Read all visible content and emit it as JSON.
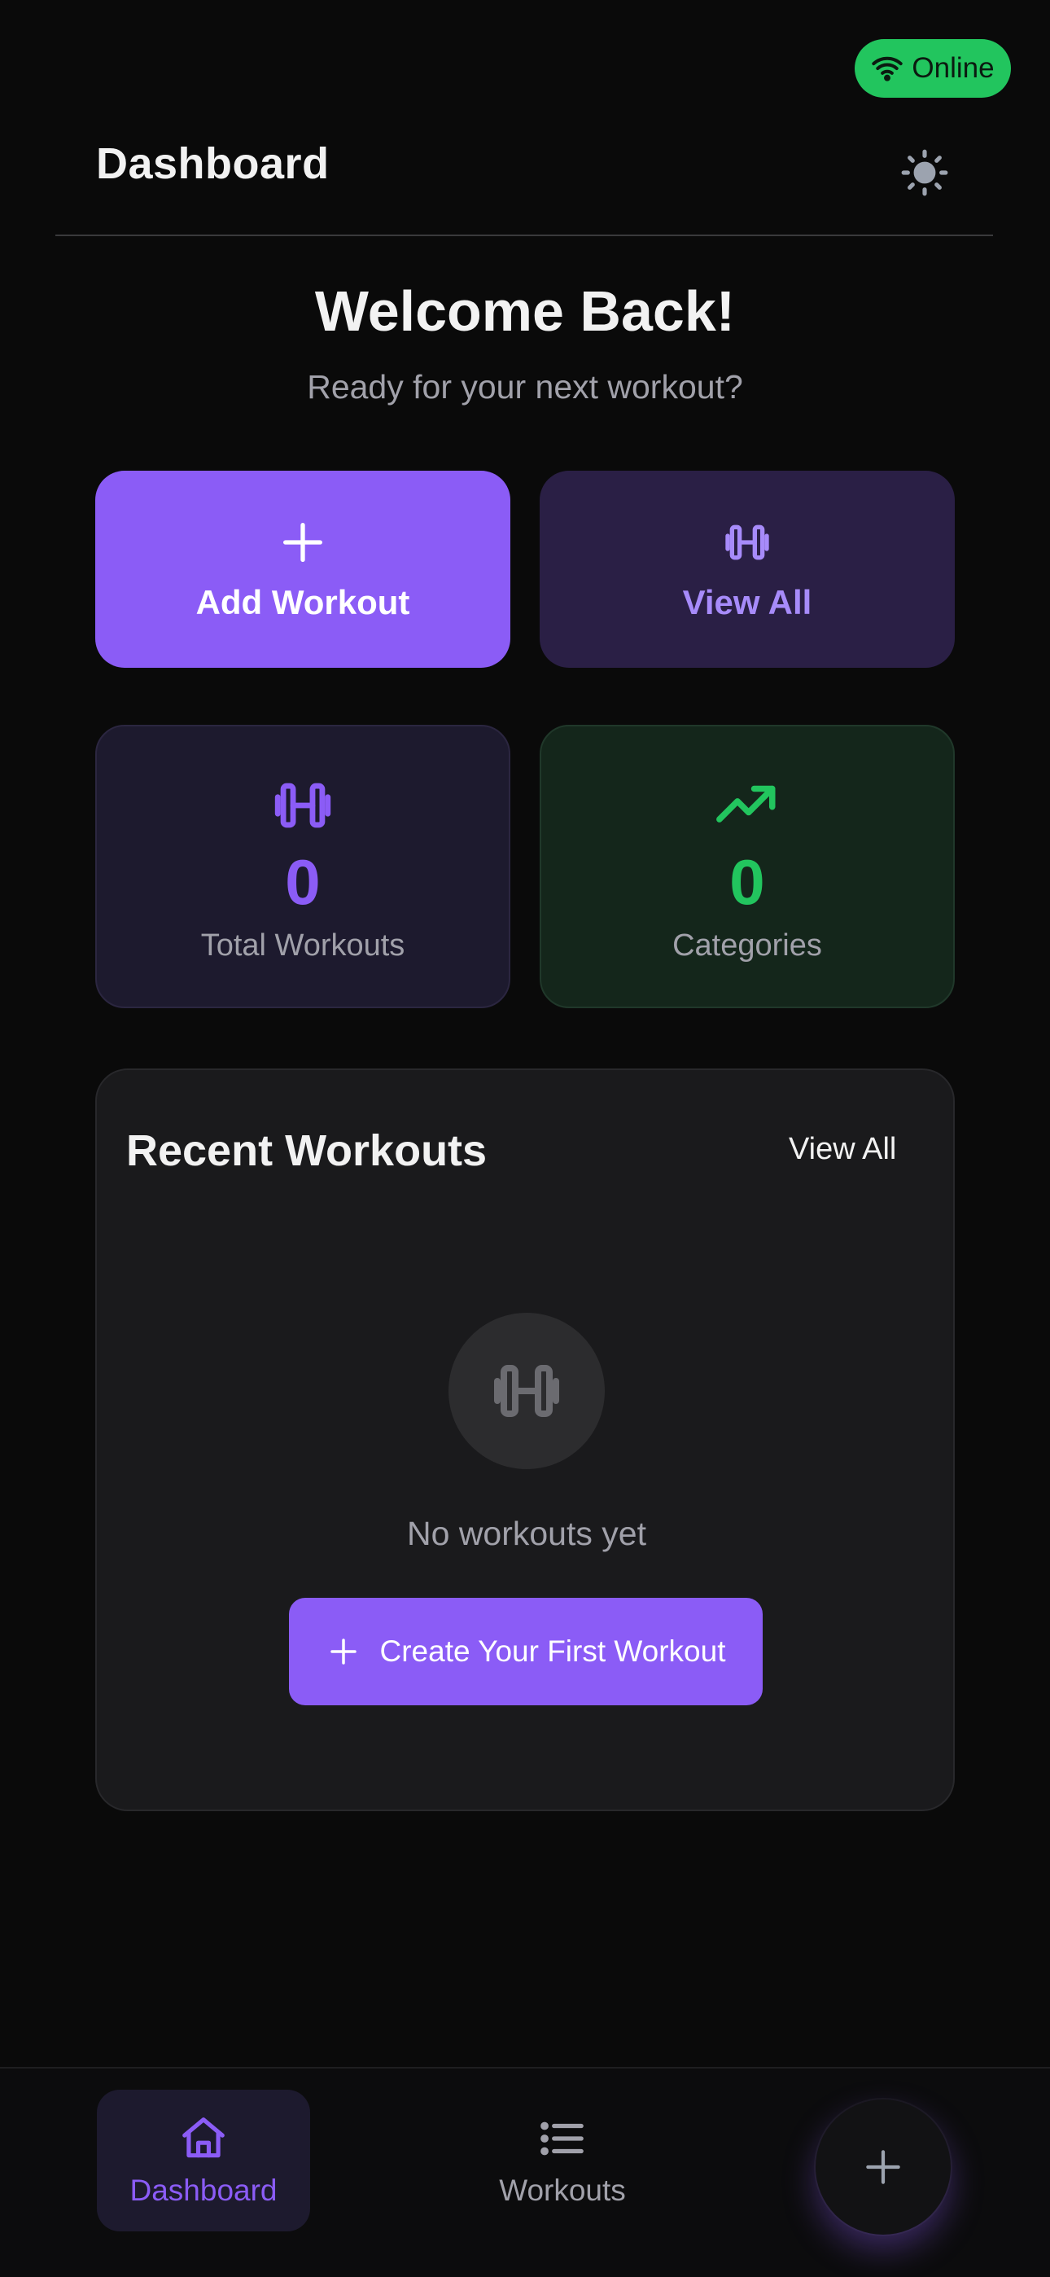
{
  "status": {
    "label": "Online",
    "icon": "wifi-icon",
    "color": "#22c55e"
  },
  "header": {
    "title": "Dashboard",
    "theme_icon": "sun-icon"
  },
  "welcome": {
    "title": "Welcome Back!",
    "subtitle": "Ready for your next workout?"
  },
  "actions": [
    {
      "label": "Add Workout",
      "icon": "plus-icon",
      "color": "#8b5cf6"
    },
    {
      "label": "View All",
      "icon": "dumbbell-icon",
      "color": "#a78bfa"
    }
  ],
  "stats": [
    {
      "value": "0",
      "label": "Total Workouts",
      "icon": "dumbbell-icon",
      "color": "#8b5cf6"
    },
    {
      "value": "0",
      "label": "Categories",
      "icon": "trending-up-icon",
      "color": "#22c55e"
    }
  ],
  "recent": {
    "title": "Recent Workouts",
    "view_all": "View All",
    "empty_icon": "dumbbell-icon",
    "empty_text": "No workouts yet",
    "create_label": "Create Your First Workout"
  },
  "nav": {
    "items": [
      {
        "label": "Dashboard",
        "icon": "home-icon",
        "active": true
      },
      {
        "label": "Workouts",
        "icon": "list-icon",
        "active": false
      }
    ],
    "fab_icon": "plus-icon"
  },
  "colors": {
    "accent": "#8b5cf6",
    "success": "#22c55e",
    "background": "#0a0a0a"
  }
}
